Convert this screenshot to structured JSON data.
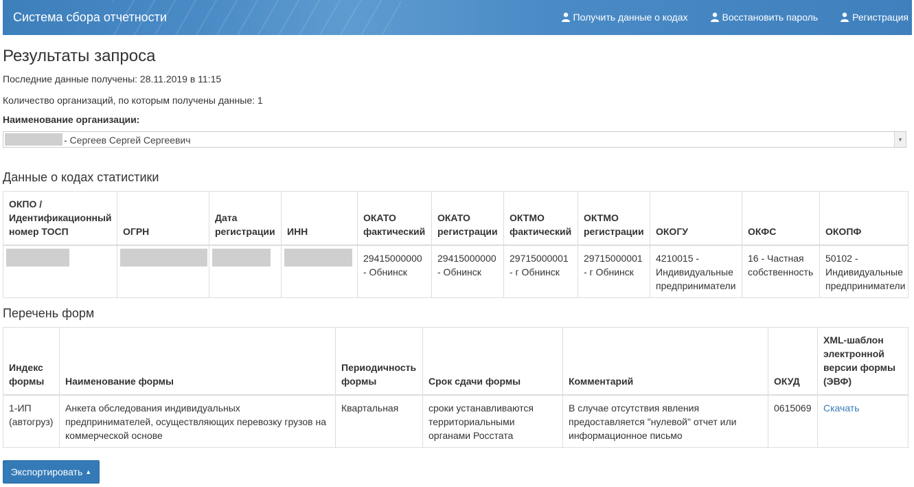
{
  "navbar": {
    "brand": "Система сбора отчетности",
    "links": [
      {
        "label": "Получить данные о кодах",
        "icon": "user-icon"
      },
      {
        "label": "Восстановить пароль",
        "icon": "user-icon"
      },
      {
        "label": "Регистрация",
        "icon": "user-icon"
      }
    ]
  },
  "page": {
    "title": "Результаты запроса",
    "last_data": "Последние данные получены: 28.11.2019 в 11:15",
    "org_count": "Количество организаций, по которым получены данные: 1",
    "org_label": "Наименование организации:",
    "org_select_value": "- Сергеев Сергей Сергеевич"
  },
  "codes": {
    "heading": "Данные о кодах статистики",
    "headers": [
      "ОКПО / Идентификационный номер ТОСП",
      "ОГРН",
      "Дата регистрации",
      "ИНН",
      "ОКАТО фактический",
      "ОКАТО регистрации",
      "ОКТМО фактический",
      "ОКТМО регистрации",
      "ОКОГУ",
      "ОКФС",
      "ОКОПФ"
    ],
    "row": [
      "",
      "",
      "",
      "",
      "29415000000 - Обнинск",
      "29415000000 - Обнинск",
      "29715000001 - г Обнинск",
      "29715000001 - г Обнинск",
      "4210015 - Индивидуальные предприниматели",
      "16 - Частная собственность",
      "50102 - Индивидуальные предприниматели"
    ]
  },
  "forms": {
    "heading": "Перечень форм",
    "headers": [
      "Индекс формы",
      "Наименование формы",
      "Периодичность формы",
      "Срок сдачи формы",
      "Комментарий",
      "ОКУД",
      "XML-шаблон электронной версии формы (ЭВФ)"
    ],
    "row": {
      "index": "1-ИП (автогруз)",
      "name": "Анкета обследования индивидуальных предпринимателей, осуществляющих перевозку грузов на коммерческой основе",
      "period": "Квартальная",
      "deadline": "сроки устанавливаются территориальными органами Росстата",
      "comment": "В случае отсутствия явления предоставляется \"нулевой\" отчет или информационное письмо",
      "okud": "0615069",
      "download": "Скачать"
    }
  },
  "export_button": "Экспортировать"
}
